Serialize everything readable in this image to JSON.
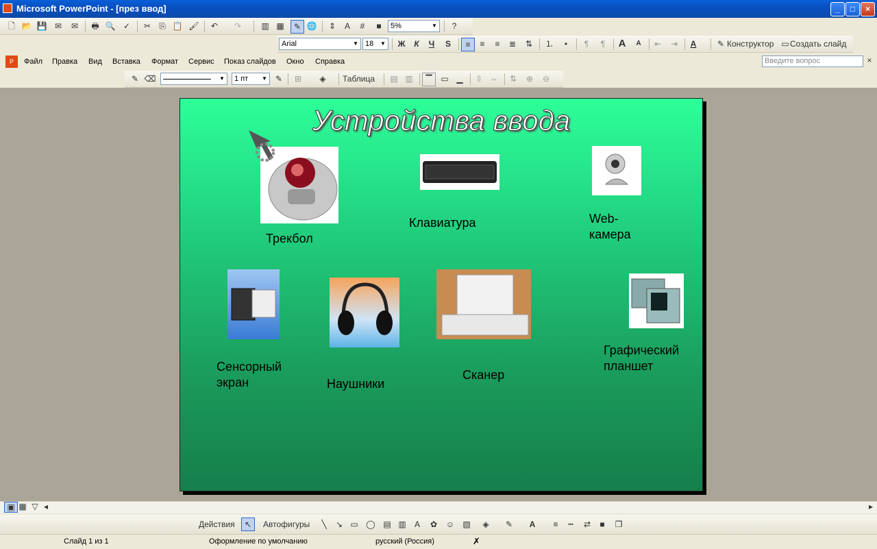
{
  "window": {
    "title": "Microsoft PowerPoint - [през ввод]",
    "min": "_",
    "max": "□",
    "close": "×"
  },
  "format_toolbar": {
    "font": "Arial",
    "size": "18",
    "zoom": "5%",
    "bold": "Ж",
    "italic": "К",
    "underline": "Ч",
    "shadow": "S",
    "designer": "Конструктор",
    "new_slide": "Создать слайд"
  },
  "menu": [
    "Файл",
    "Правка",
    "Вид",
    "Вставка",
    "Формат",
    "Сервис",
    "Показ слайдов",
    "Окно",
    "Справка"
  ],
  "help_search": {
    "placeholder": "Введите вопрос"
  },
  "tables_toolbar": {
    "line_width": "1 пт",
    "table_label": "Таблица"
  },
  "slide": {
    "title": "Устройства ввода",
    "captions": {
      "trackball": "Трекбол",
      "keyboard": "Клавиатура",
      "webcam": "Web-камера",
      "touchscreen": "Сенсорный экран",
      "headphones": "Наушники",
      "scanner": "Сканер",
      "tablet": "Графический планшет"
    }
  },
  "draw_toolbar": {
    "actions": "Действия",
    "autoshapes": "Автофигуры"
  },
  "status": {
    "slide": "Слайд 1 из 1",
    "design": "Оформление по умолчанию",
    "language": "русский (Россия)"
  },
  "colors": {
    "slide_top": "#2dff99",
    "slide_bottom": "#167e4b",
    "titlebar": "#0a5fd8"
  }
}
